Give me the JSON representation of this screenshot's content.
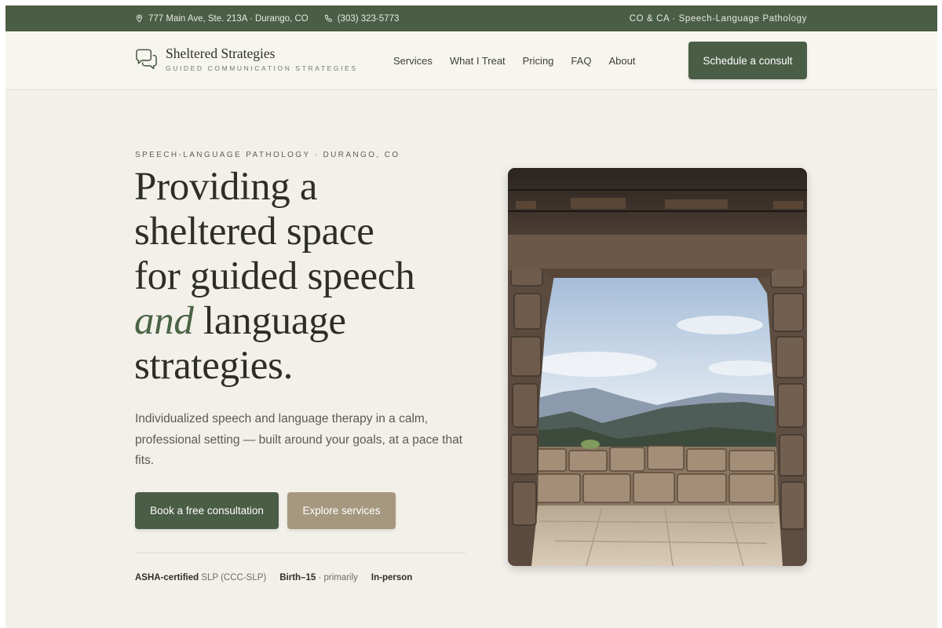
{
  "topbar": {
    "address": "777 Main Ave, Ste. 213A · Durango, CO",
    "phone": "(303) 323-5773",
    "right": "CO & CA · Speech-Language Pathology"
  },
  "brand": {
    "name": "Sheltered Strategies",
    "tagline": "GUIDED COMMUNICATION STRATEGIES"
  },
  "nav": {
    "items": [
      {
        "label": "Services"
      },
      {
        "label": "What I Treat"
      },
      {
        "label": "Pricing"
      },
      {
        "label": "FAQ"
      },
      {
        "label": "About"
      }
    ],
    "cta": "Schedule a consult"
  },
  "hero": {
    "eyebrow": "SPEECH-LANGUAGE PATHOLOGY · DURANGO, CO",
    "headline_line1": "Providing a",
    "headline_line2": "sheltered space",
    "headline_line3": "for guided speech",
    "headline_em": "and",
    "headline_line4_rest": " language",
    "headline_line5": "strategies.",
    "lead": "Individualized speech and language therapy in a calm, professional setting — built around your goals, at a pace that fits.",
    "primary_button": "Book a free consultation",
    "secondary_button": "Explore services",
    "meta": [
      {
        "strong": "ASHA-certified",
        "rest": " SLP (CCC-SLP)"
      },
      {
        "strong": "Birth–15",
        "rest": " · primarily"
      },
      {
        "strong": "In-person",
        "rest": ""
      }
    ]
  },
  "colors": {
    "brand_green": "#4a5d45",
    "tan": "#a5987f",
    "background": "#f3f0ea"
  },
  "icons": {
    "topbar_address": "map-pin-icon",
    "topbar_phone": "phone-icon",
    "brand": "chat-bubbles-icon"
  }
}
